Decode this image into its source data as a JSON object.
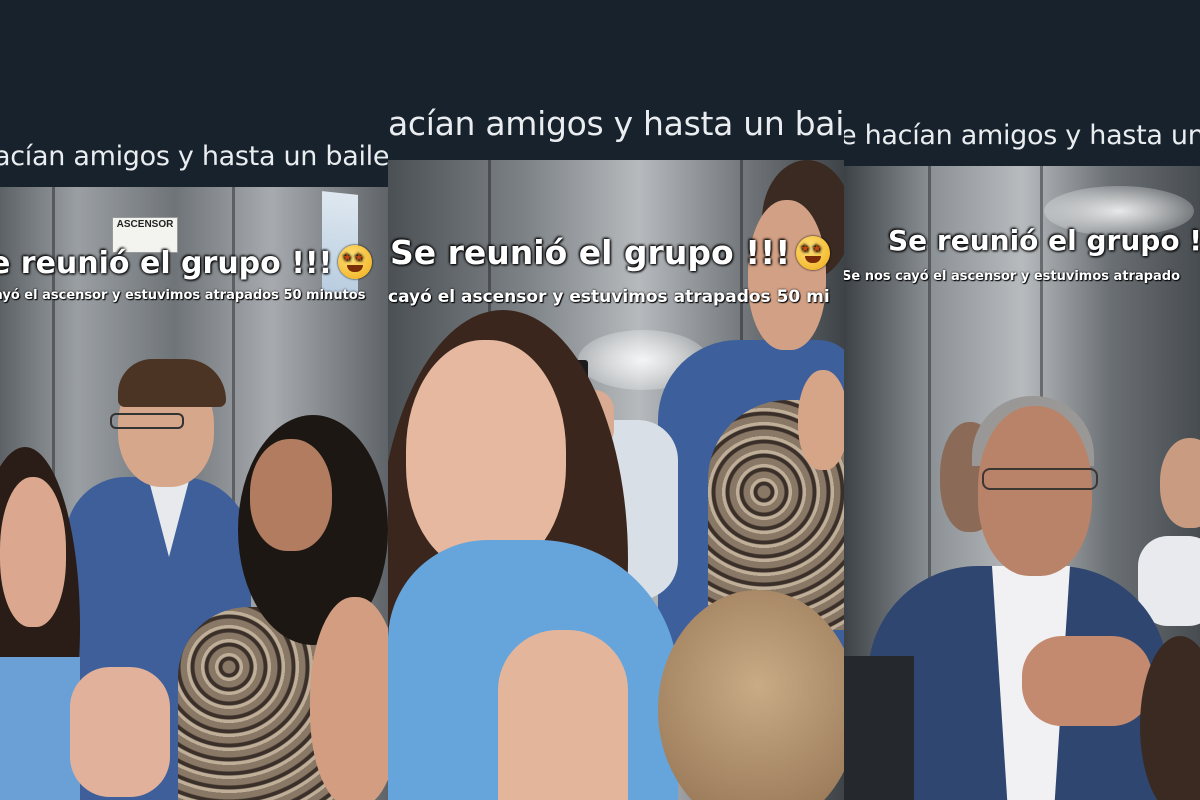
{
  "panels": [
    {
      "caption": "acían amigos y hasta un baile",
      "overlay_title": "e reunió el grupo !!!",
      "overlay_subtitle": "ayó el ascensor y estuvimos atrapados 50 minutos",
      "sign_text": "ASCENSOR"
    },
    {
      "caption": "acían amigos y hasta un baile",
      "overlay_title": "Se reunió el grupo !!!",
      "overlay_subtitle": "cayó el ascensor y estuvimos atrapados 50 mi"
    },
    {
      "caption": "e hacían amigos y hasta un baile",
      "overlay_title": "Se reunió el grupo !!",
      "overlay_subtitle": "Se nos cayó el ascensor y estuvimos atrapado"
    }
  ],
  "colors": {
    "background": "#18222c",
    "caption_text": "#e9edf0",
    "overlay_text": "#ffffff"
  }
}
